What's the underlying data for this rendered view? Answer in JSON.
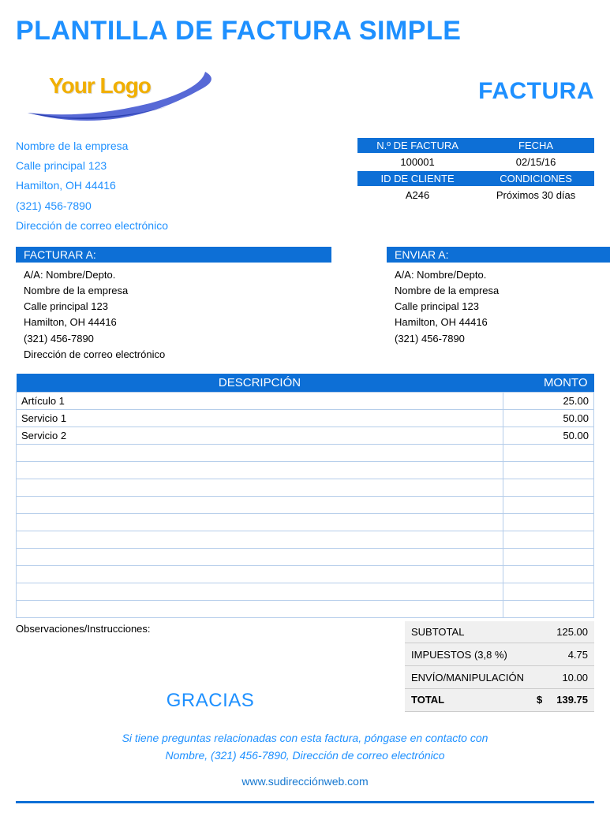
{
  "title": "PLANTILLA DE FACTURA SIMPLE",
  "logo_text": "Your Logo",
  "invoice_label": "FACTURA",
  "company": {
    "name": "Nombre de la empresa",
    "street": "Calle principal 123",
    "city": "Hamilton, OH 44416",
    "phone": "(321) 456-7890",
    "email": "Dirección de correo electrónico"
  },
  "meta": {
    "invoice_no_label": "N.º DE FACTURA",
    "date_label": "FECHA",
    "invoice_no": "100001",
    "date": "02/15/16",
    "client_id_label": "ID DE CLIENTE",
    "terms_label": "CONDICIONES",
    "client_id": "A246",
    "terms": "Próximos 30 días"
  },
  "bill_to_label": "FACTURAR A:",
  "ship_to_label": "ENVIAR A:",
  "bill_to": {
    "attn": "A/A: Nombre/Depto.",
    "name": "Nombre de la empresa",
    "street": "Calle principal 123",
    "city": "Hamilton, OH 44416",
    "phone": "(321) 456-7890",
    "email": "Dirección de correo electrónico"
  },
  "ship_to": {
    "attn": "A/A: Nombre/Depto.",
    "name": "Nombre de la empresa",
    "street": "Calle principal 123",
    "city": "Hamilton, OH 44416",
    "phone": "(321) 456-7890"
  },
  "table": {
    "desc_header": "DESCRIPCIÓN",
    "amount_header": "MONTO",
    "rows": [
      {
        "desc": "Artículo 1",
        "amount": "25.00"
      },
      {
        "desc": "Servicio 1",
        "amount": "50.00"
      },
      {
        "desc": "Servicio 2",
        "amount": "50.00"
      },
      {
        "desc": "",
        "amount": ""
      },
      {
        "desc": "",
        "amount": ""
      },
      {
        "desc": "",
        "amount": ""
      },
      {
        "desc": "",
        "amount": ""
      },
      {
        "desc": "",
        "amount": ""
      },
      {
        "desc": "",
        "amount": ""
      },
      {
        "desc": "",
        "amount": ""
      },
      {
        "desc": "",
        "amount": ""
      },
      {
        "desc": "",
        "amount": ""
      },
      {
        "desc": "",
        "amount": ""
      }
    ]
  },
  "remarks_label": "Observaciones/Instrucciones:",
  "thanks": "GRACIAS",
  "totals": {
    "subtotal_label": "SUBTOTAL",
    "subtotal": "125.00",
    "tax_label": "IMPUESTOS (3,8 %)",
    "tax": "4.75",
    "shipping_label": "ENVÍO/MANIPULACIÓN",
    "shipping": "10.00",
    "total_label": "TOTAL",
    "currency": "$",
    "total": "139.75"
  },
  "footer": {
    "line1": "Si tiene preguntas relacionadas con esta factura, póngase en contacto con",
    "line2": "Nombre, (321) 456-7890, Dirección de correo electrónico",
    "url": "www.sudirecciónweb.com"
  }
}
